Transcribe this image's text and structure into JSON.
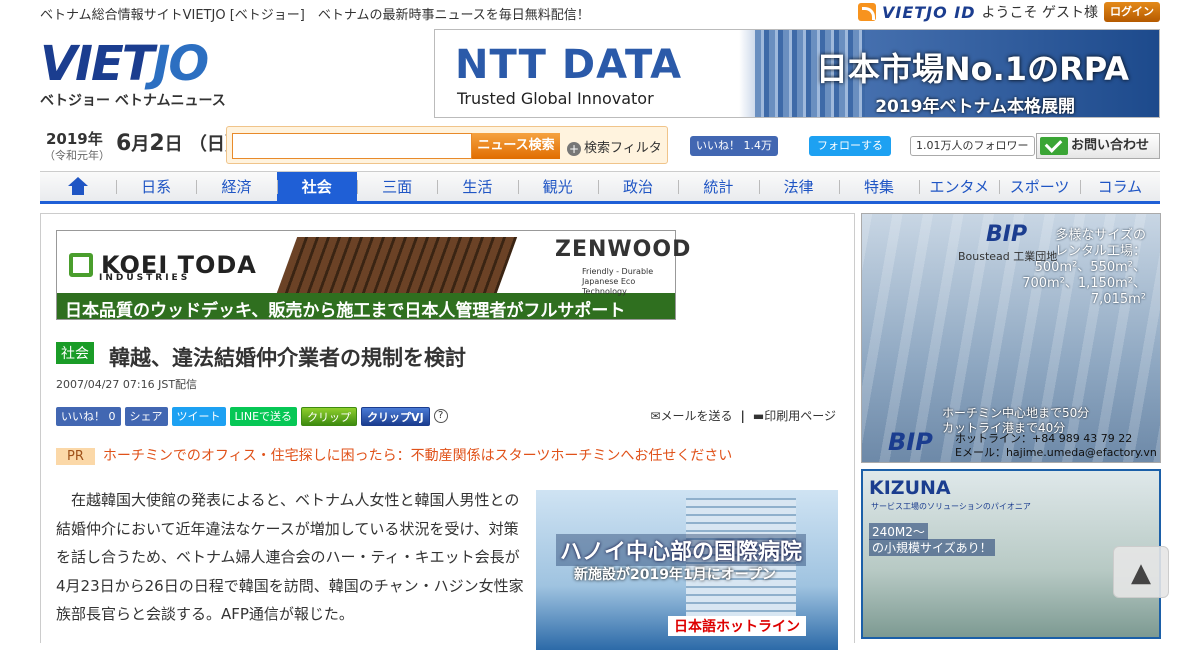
{
  "header": {
    "tagline": "ベトナム総合情報サイトVIETJO [ベトジョー]　ベトナムの最新時事ニュースを毎日無料配信！",
    "vietjo_id": "VIETJO ID",
    "welcome": "ようこそ ゲスト様",
    "login": "ログイン"
  },
  "logo": {
    "main": "VIETJO",
    "sub": "ベトジョー ベトナムニュース"
  },
  "top_banner": {
    "brand": "NTT DATA",
    "slogan": "Trusted Global Innovator",
    "headline": "日本市場No.1のRPA",
    "subline": "2019年ベトナム本格展開"
  },
  "date": {
    "year": "2019年",
    "era": "（令和元年）",
    "month": "6",
    "month_unit": "月",
    "day": "2",
    "day_unit": "日",
    "weekday": "（日）"
  },
  "search": {
    "placeholder": "",
    "button": "ニュース検索",
    "filter": "検索フィルタ"
  },
  "social": {
    "fb_like": "いいね！ 1.4万",
    "tw_follow": "フォローする",
    "tw_count": "1.01万人のフォロワー",
    "contact": "お問い合わせ"
  },
  "nav": [
    {
      "label": "日系"
    },
    {
      "label": "経済"
    },
    {
      "label": "社会"
    },
    {
      "label": "三面"
    },
    {
      "label": "生活"
    },
    {
      "label": "観光"
    },
    {
      "label": "政治"
    },
    {
      "label": "統計"
    },
    {
      "label": "法律"
    },
    {
      "label": "特集"
    },
    {
      "label": "エンタメ"
    },
    {
      "label": "スポーツ"
    },
    {
      "label": "コラム"
    }
  ],
  "nav_active": "社会",
  "ad_koei": {
    "brand": "KOEI TODA",
    "brand_sub": "INDUSTRIES",
    "zenwood": "ZENWOOD",
    "zenwood_sub": "Friendly - Durable Japanese Eco Technology",
    "bottom": "日本品質のウッドデッキ、販売から施工まで日本人管理者がフルサポート"
  },
  "article": {
    "category": "社会",
    "title": "韓越、違法結婚仲介業者の規制を検討",
    "date": "2007/04/27 07:16 JST配信",
    "share": {
      "fb_like": "いいね！ 0",
      "fb_share": "シェア",
      "tweet": "ツイート",
      "line": "LINEで送る",
      "clip": "クリップ",
      "clip_vj": "クリップVJ",
      "help": "?"
    },
    "mail": "メールを送る",
    "sep": "|",
    "print": "印刷用ページ",
    "pr_tag": "PR",
    "pr_text": "ホーチミンでのオフィス・住宅探しに困ったら：不動産関係はスターツホーチミンへお任せください",
    "body": "在越韓国大使館の発表によると、ベトナム人女性と韓国人男性との結婚仲介において近年違法なケースが増加している状況を受け、対策を話し合うため、ベトナム婦人連合会のハー・ティ・キエット会長が4月23日から26日の日程で韓国を訪問、韓国のチャン・ハジン女性家族部長官らと会談する。AFP通信が報じた。"
  },
  "ad_hospital": {
    "title": "ハノイ中心部の国際病院",
    "sub": "新施設が2019年1月にオープン",
    "hotline": "日本語ホットライン"
  },
  "ad_bip": {
    "logo": "BIP",
    "sub": "Boustead 工業団地",
    "sizes": [
      "多様なサイズの",
      "レンタル工場：",
      "500m²、550m²、",
      "700m²、1,150m²、",
      "7,015m²"
    ],
    "dist1": "ホーチミン中心地まで50分",
    "dist2": "カットライ港まで40分",
    "hotline": "ホットライン：+84 989 43 79 22",
    "email": "Eメール：hajime.umeda@efactory.vn"
  },
  "ad_kizuna": {
    "logo": "KIZUNA",
    "sub": "サービス工場のソリューションのパイオニア",
    "line1": "240M2～",
    "line2": "の小規模サイズあり！"
  },
  "to_top": "▲"
}
